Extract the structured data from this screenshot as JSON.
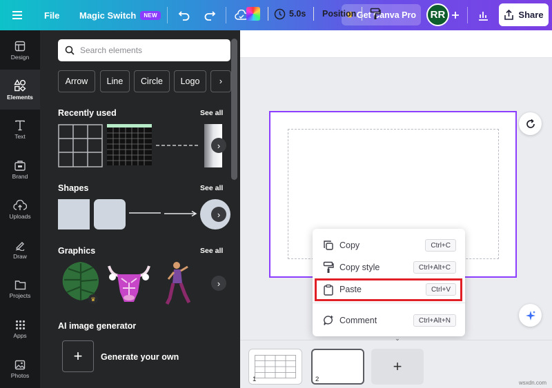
{
  "topbar": {
    "file": "File",
    "magic_switch": "Magic Switch",
    "new_badge": "NEW",
    "get_pro": "Get Canva Pro",
    "avatar_initials": "RR",
    "share": "Share",
    "icons": [
      "menu-icon",
      "undo-icon",
      "redo-icon",
      "cloud-save-icon",
      "crown-icon",
      "plus-icon",
      "analytics-icon",
      "share-upload-icon"
    ]
  },
  "rail": {
    "items": [
      {
        "label": "Design",
        "icon": "design-icon"
      },
      {
        "label": "Elements",
        "icon": "elements-icon",
        "active": true
      },
      {
        "label": "Text",
        "icon": "text-icon"
      },
      {
        "label": "Brand",
        "icon": "brand-icon"
      },
      {
        "label": "Uploads",
        "icon": "uploads-icon"
      },
      {
        "label": "Draw",
        "icon": "draw-icon"
      },
      {
        "label": "Projects",
        "icon": "projects-icon"
      },
      {
        "label": "Apps",
        "icon": "apps-icon"
      },
      {
        "label": "Photos",
        "icon": "photos-icon"
      }
    ]
  },
  "panel": {
    "search_placeholder": "Search elements",
    "chips": [
      "Arrow",
      "Line",
      "Circle",
      "Logo"
    ],
    "recently_used": "Recently used",
    "shapes": "Shapes",
    "graphics": "Graphics",
    "see_all": "See all",
    "ai_title": "AI image generator",
    "generate": "Generate your own"
  },
  "toolbar": {
    "duration": "5.0s",
    "position": "Position"
  },
  "context_menu": {
    "items": [
      {
        "label": "Copy",
        "shortcut": "Ctrl+C",
        "icon": "copy-icon"
      },
      {
        "label": "Copy style",
        "shortcut": "Ctrl+Alt+C",
        "icon": "paint-roller-icon"
      },
      {
        "label": "Paste",
        "shortcut": "Ctrl+V",
        "icon": "clipboard-icon"
      },
      {
        "label": "Comment",
        "shortcut": "Ctrl+Alt+N",
        "icon": "comment-icon"
      }
    ]
  },
  "pages": {
    "thumbnails": [
      "1",
      "2"
    ]
  },
  "watermark": "wsxdn.com",
  "colors": {
    "accent": "#8b3dff",
    "highlight": "#e01f26",
    "panel_bg": "#252627",
    "rail_bg": "#18191b"
  }
}
